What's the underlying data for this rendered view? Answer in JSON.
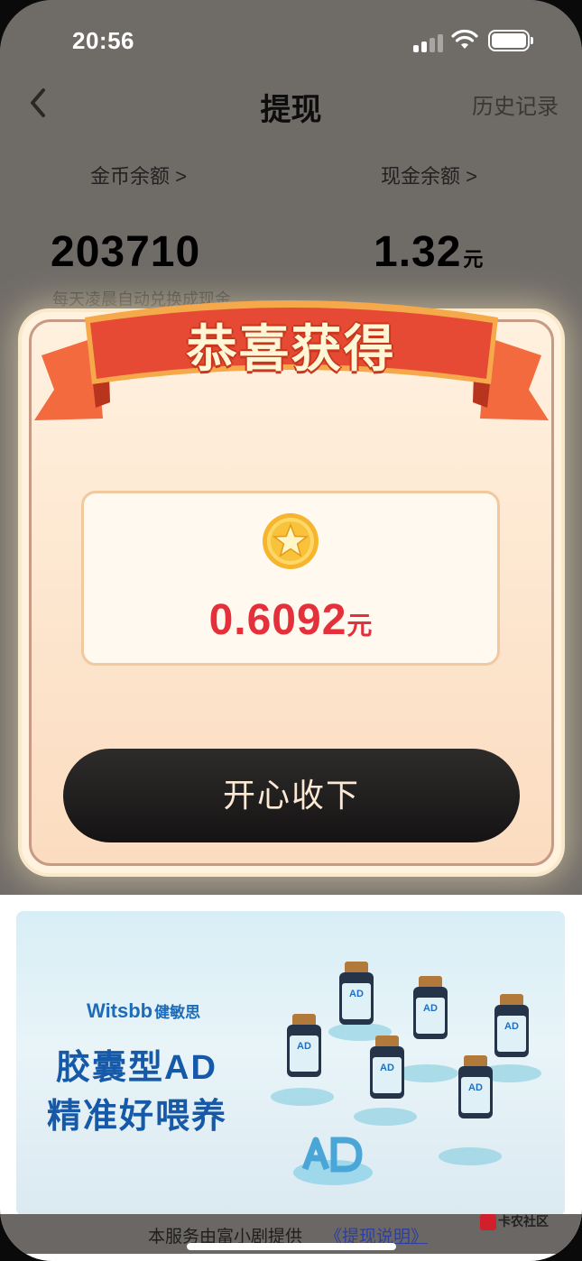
{
  "status_bar": {
    "time": "20:56"
  },
  "nav": {
    "title": "提现",
    "history_label": "历史记录"
  },
  "balances": {
    "coin_label": "金币余额 >",
    "coin_value": "203710",
    "cash_label": "现金余额 >",
    "cash_value": "1.32",
    "cash_unit": "元",
    "note": "每天凌晨自动兑换成现金"
  },
  "popup": {
    "title": "恭喜获得",
    "amount": "0.6092",
    "amount_unit": "元",
    "accept_label": "开心收下"
  },
  "ad": {
    "brand": "Witsbb",
    "brand_cn": "健敏思",
    "line1": "胶囊型AD",
    "line2": "精准好喂养",
    "bottle_mark": "AD"
  },
  "footer": {
    "text": "本服务由富小剧提供",
    "link": "《提现说明》"
  },
  "watermark": "卡农社区",
  "colors": {
    "amount": "#e3303a",
    "ribbon": "#e8503a",
    "button": "#1e1b1b"
  }
}
